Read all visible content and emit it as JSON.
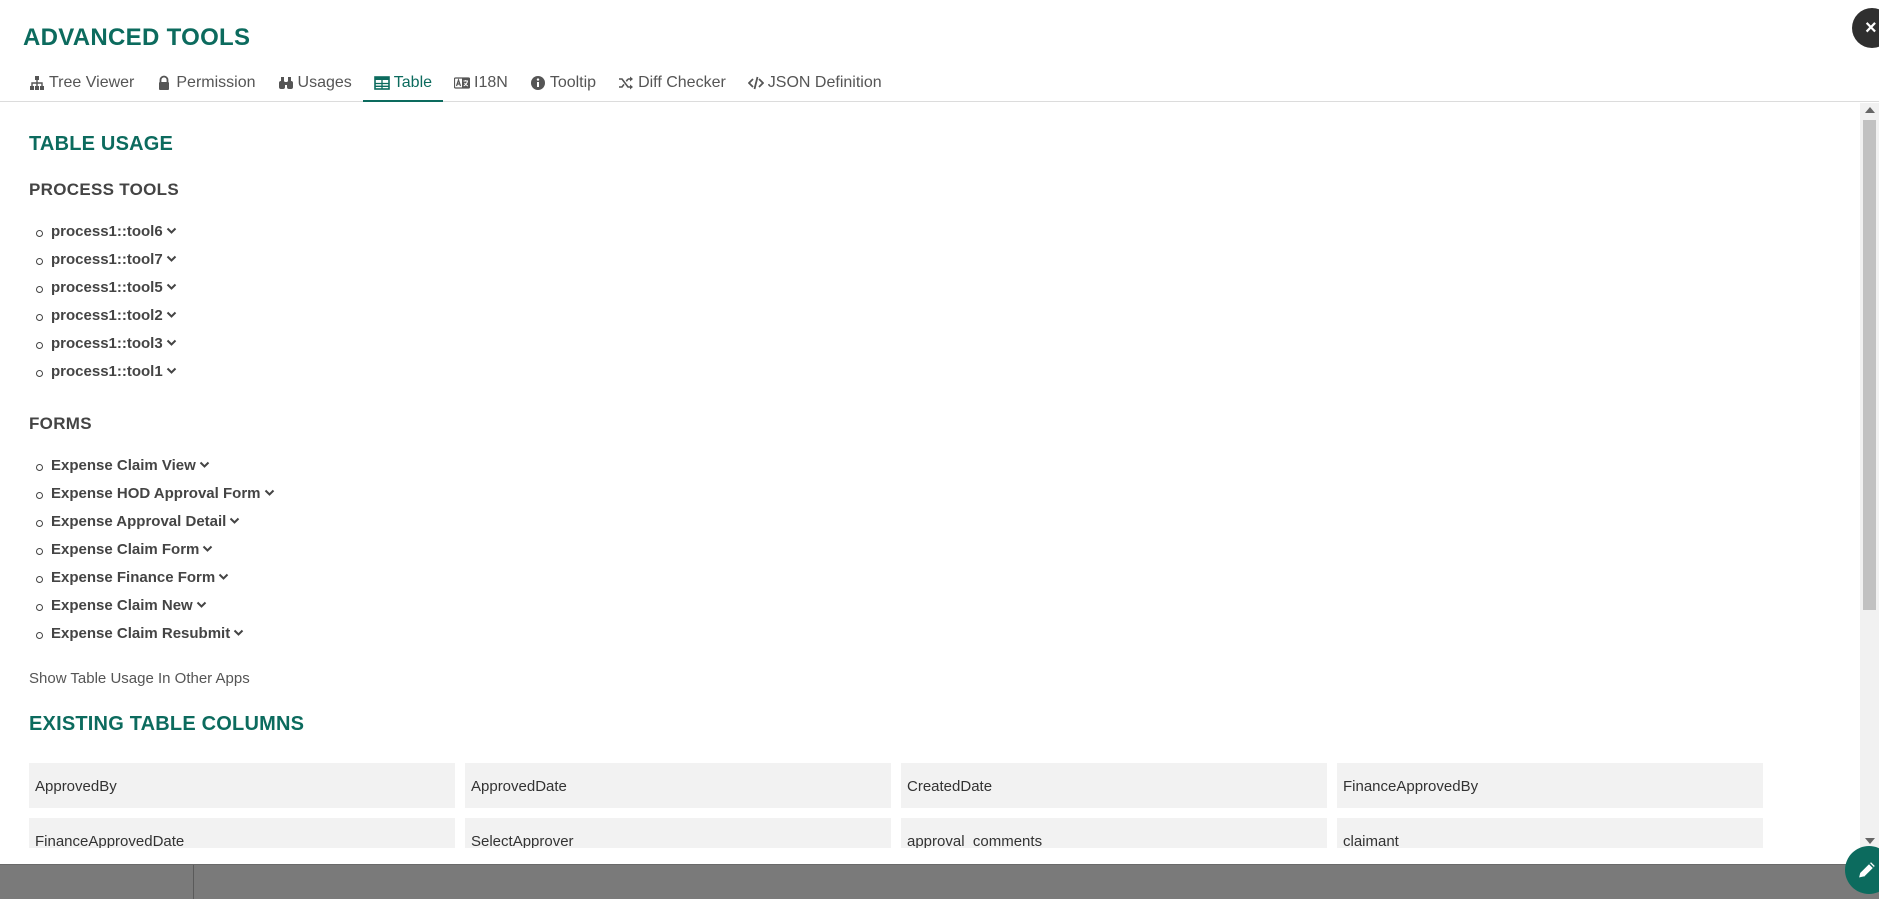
{
  "modal": {
    "title": "ADVANCED TOOLS",
    "close_label": "×"
  },
  "tabs": [
    {
      "label": "Tree Viewer",
      "icon": "sitemap-icon"
    },
    {
      "label": "Permission",
      "icon": "lock-icon"
    },
    {
      "label": "Usages",
      "icon": "binoculars-icon"
    },
    {
      "label": "Table",
      "icon": "table-icon",
      "active": true
    },
    {
      "label": "I18N",
      "icon": "language-icon"
    },
    {
      "label": "Tooltip",
      "icon": "info-circle-icon"
    },
    {
      "label": "Diff Checker",
      "icon": "random-icon"
    },
    {
      "label": "JSON Definition",
      "icon": "code-icon"
    }
  ],
  "table_usage": {
    "title": "TABLE USAGE",
    "process_tools": {
      "title": "PROCESS TOOLS",
      "items": [
        "process1::tool6",
        "process1::tool7",
        "process1::tool5",
        "process1::tool2",
        "process1::tool3",
        "process1::tool1"
      ]
    },
    "forms": {
      "title": "FORMS",
      "items": [
        "Expense Claim View",
        "Expense HOD Approval Form",
        "Expense Approval Detail",
        "Expense Claim Form",
        "Expense Finance Form",
        "Expense Claim New",
        "Expense Claim Resubmit"
      ]
    },
    "other_apps_link": "Show Table Usage In Other Apps"
  },
  "existing_columns": {
    "title": "EXISTING TABLE COLUMNS",
    "columns": [
      "ApprovedBy",
      "ApprovedDate",
      "CreatedDate",
      "FinanceApprovedBy",
      "FinanceApprovedDate",
      "SelectApprover",
      "approval_comments",
      "claimant"
    ]
  },
  "colors": {
    "accent": "#0c6b5e",
    "bottom_bar": "#7a7a7a"
  }
}
